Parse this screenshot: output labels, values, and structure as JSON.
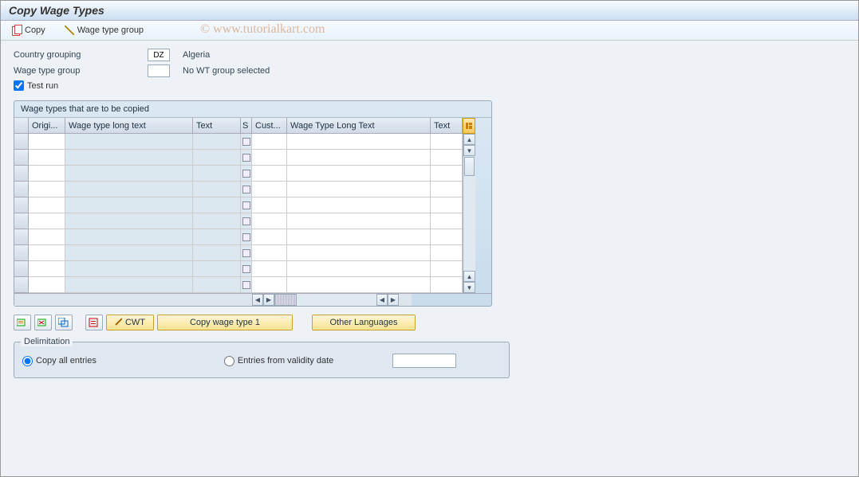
{
  "title": "Copy Wage Types",
  "watermark": "© www.tutorialkart.com",
  "toolbar": {
    "copy_label": "Copy",
    "wage_type_group_label": "Wage type group"
  },
  "form": {
    "country_grouping_label": "Country grouping",
    "country_grouping_value": "DZ",
    "country_grouping_text": "Algeria",
    "wage_type_group_label": "Wage type group",
    "wage_type_group_value": "",
    "wage_type_group_text": "No WT group selected",
    "test_run_label": "Test run",
    "test_run_checked": true
  },
  "table": {
    "title": "Wage types that are to be copied",
    "columns_left": [
      "Origi...",
      "Wage type long text",
      "Text"
    ],
    "columns_right": [
      "S",
      "Cust...",
      "Wage Type Long Text",
      "Text"
    ],
    "row_count": 10
  },
  "buttons": {
    "cwt": "CWT",
    "copy_wage_type_1": "Copy wage type 1",
    "other_languages": "Other Languages"
  },
  "delimitation": {
    "legend": "Delimitation",
    "copy_all": "Copy all entries",
    "entries_from": "Entries from validity date",
    "date_value": "",
    "selected": "copy_all"
  }
}
